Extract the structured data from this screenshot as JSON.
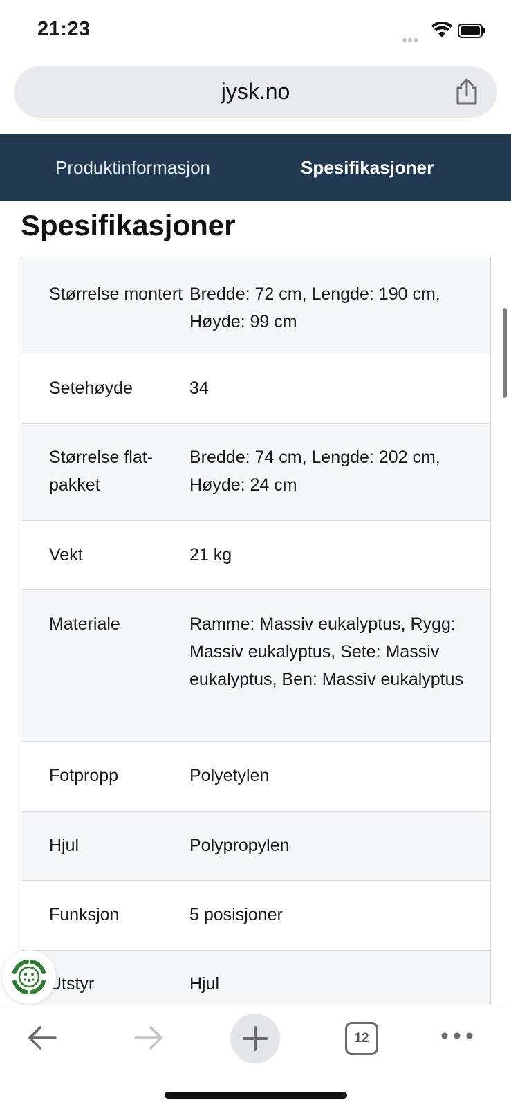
{
  "status_bar": {
    "time": "21:23",
    "icons": [
      "signal-dots-icon",
      "wifi-icon",
      "battery-icon"
    ]
  },
  "url_bar": {
    "domain": "jysk.no",
    "share_icon": "share-icon"
  },
  "tab_nav": {
    "tabs": [
      {
        "label": "Produktinformasjon",
        "active": false
      },
      {
        "label": "Spesifikasjoner",
        "active": true
      }
    ]
  },
  "section": {
    "title": "Spesifikasjoner"
  },
  "specs": {
    "rows": [
      {
        "label": "Størrelse montert",
        "value": "Bredde: 72 cm, Lengde: 190 cm, Høyde: 99 cm"
      },
      {
        "label": "Setehøyde",
        "value": "34"
      },
      {
        "label": "Størrelse flat-pakket",
        "value": "Bredde: 74 cm, Lengde: 202 cm, Høyde: 24 cm"
      },
      {
        "label": "Vekt",
        "value": "21 kg"
      },
      {
        "label": "Materiale",
        "value": "Ramme: Massiv eukalyptus, Rygg: Massiv eukalyptus, Sete: Massiv eukalyptus, Ben: Massiv eukalyptus"
      },
      {
        "label": "Fotpropp",
        "value": "Polyetylen"
      },
      {
        "label": "Hjul",
        "value": "Polypropylen"
      },
      {
        "label": "Funksjon",
        "value": "5 posisjoner"
      },
      {
        "label": "Utstyr",
        "value": "Hjul"
      }
    ]
  },
  "toolbar": {
    "tab_count": "12",
    "buttons": [
      "back-arrow-icon",
      "forward-arrow-icon",
      "plus-icon",
      "tabs-icon",
      "more-icon"
    ]
  },
  "colors": {
    "nav_bg": "#223a51",
    "row_shade": "#f6f7f9",
    "eco_green": "#2e7d32"
  }
}
